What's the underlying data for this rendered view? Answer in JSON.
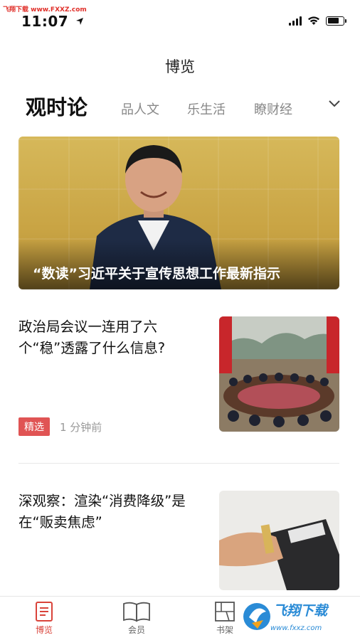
{
  "watermark": {
    "top_text": "飞翔下载 www.FXXZ.com",
    "brand": "飞翔下载",
    "url": "www.fxxz.com"
  },
  "status_bar": {
    "time": "11:07",
    "battery_level": 0.75
  },
  "header": {
    "title": "博览"
  },
  "tabs": [
    {
      "label": "观时论",
      "active": true
    },
    {
      "label": "品人文",
      "active": false
    },
    {
      "label": "乐生活",
      "active": false
    },
    {
      "label": "瞭财经",
      "active": false
    }
  ],
  "hero": {
    "caption": "“数读”习近平关于宣传思想工作最新指示"
  },
  "articles": [
    {
      "title": "政治局会议一连用了六个“稳”透露了什么信息?",
      "tag": "精选",
      "time_ago": "1 分钟前"
    },
    {
      "title": "深观察：渲染“消费降级”是在“贩卖焦虑”",
      "tag": "",
      "time_ago": ""
    }
  ],
  "bottom_nav": [
    {
      "label": "博览",
      "active": true
    },
    {
      "label": "会员",
      "active": false
    },
    {
      "label": "书架",
      "active": false
    }
  ],
  "colors": {
    "accent": "#d9433a",
    "tag_bg": "#e05454"
  }
}
